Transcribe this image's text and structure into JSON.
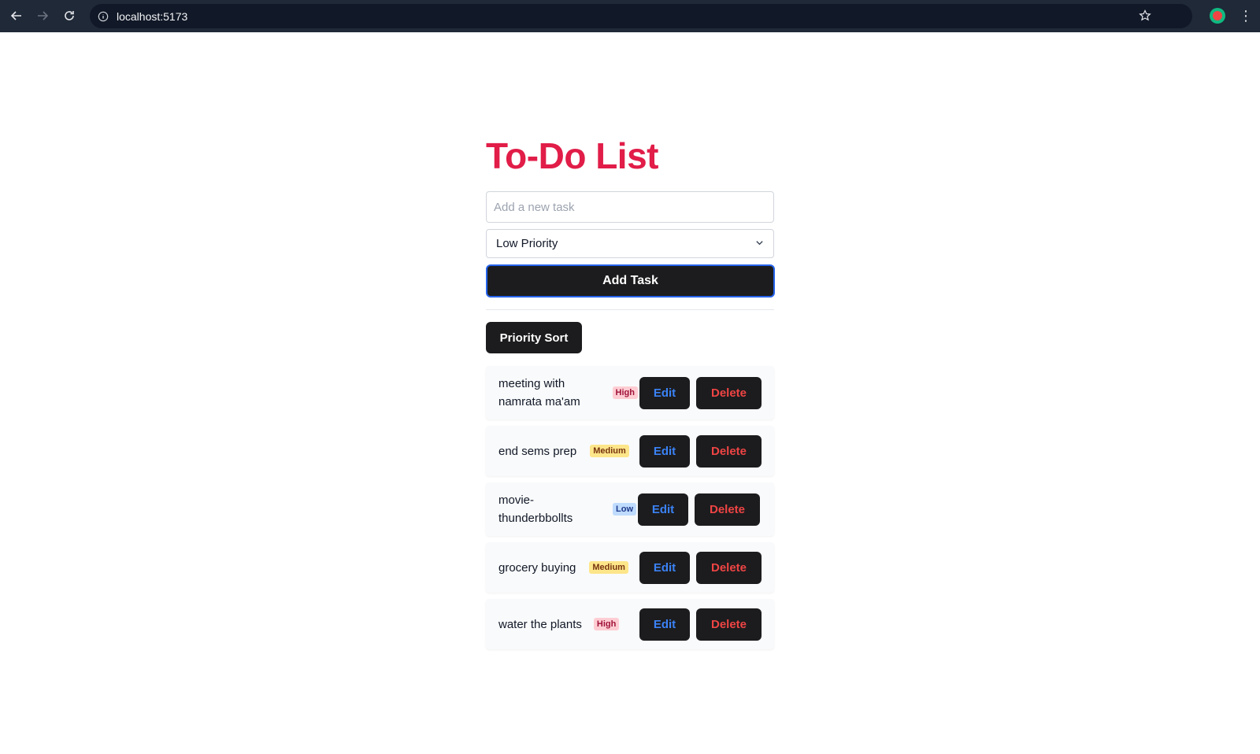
{
  "browser": {
    "url": "localhost:5173"
  },
  "app": {
    "title": "To-Do List",
    "task_input_placeholder": "Add a new task",
    "priority_select_value": "Low Priority",
    "add_task_label": "Add Task",
    "priority_sort_label": "Priority Sort",
    "edit_label": "Edit",
    "delete_label": "Delete",
    "tasks": [
      {
        "text": "meeting with namrata ma'am",
        "priority": "High"
      },
      {
        "text": "end sems prep",
        "priority": "Medium"
      },
      {
        "text": "movie-thunderbbollts",
        "priority": "Low"
      },
      {
        "text": "grocery buying",
        "priority": "Medium"
      },
      {
        "text": "water the plants",
        "priority": "High"
      }
    ]
  },
  "colors": {
    "title": "#e11d48",
    "chrome_bg": "#1f2937",
    "button_bg": "#1c1c1e",
    "edit_text": "#3b82f6",
    "delete_text": "#ef4444"
  }
}
